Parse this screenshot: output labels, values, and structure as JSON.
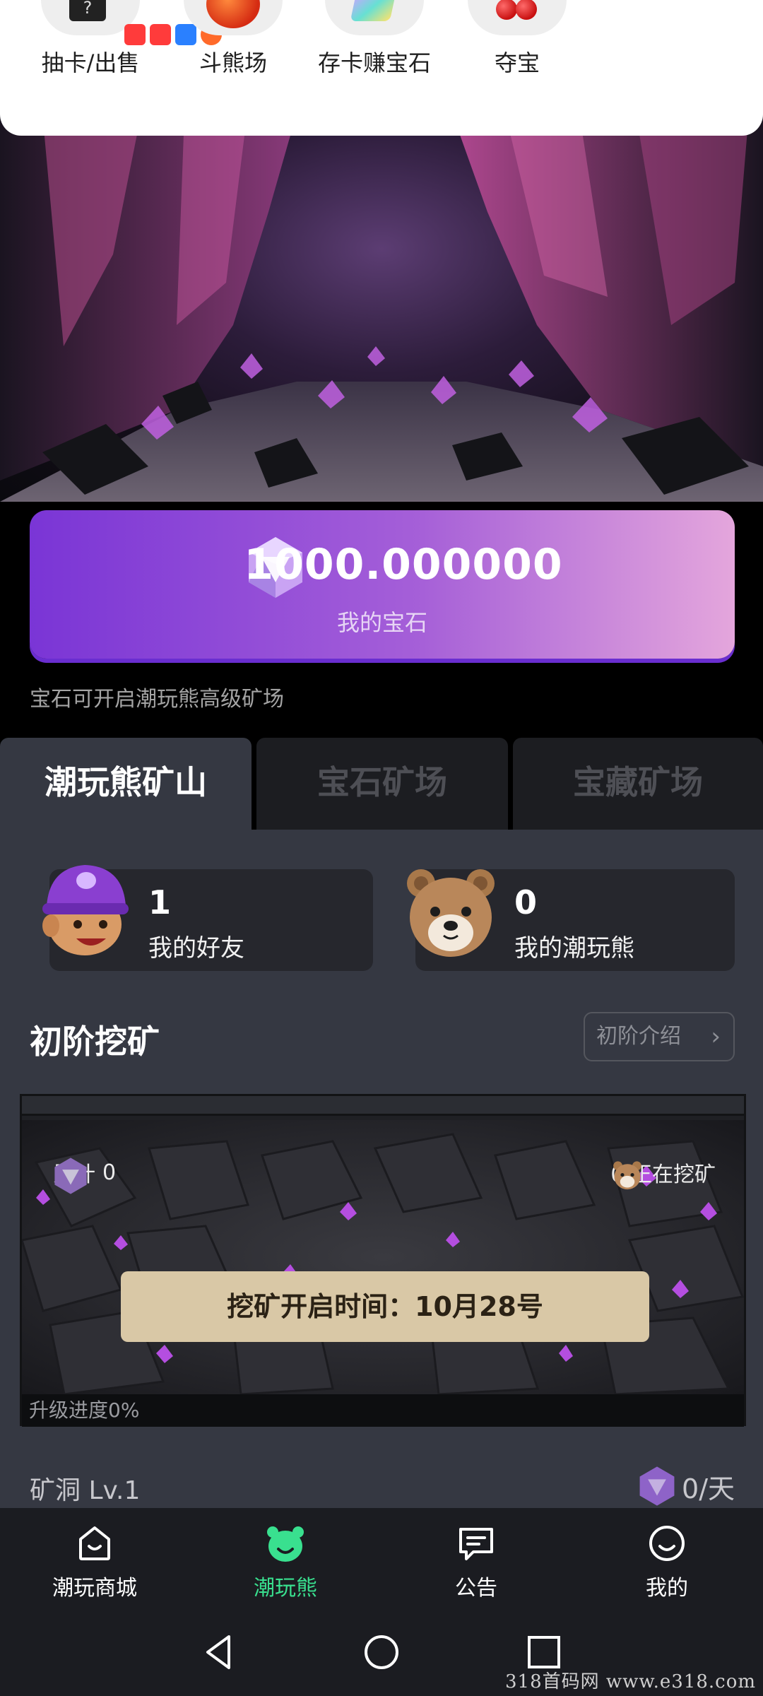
{
  "quick_actions": [
    {
      "label": "抽卡/出售",
      "icon": "mystery-box-icon"
    },
    {
      "label": "斗熊场",
      "icon": "apple-icon"
    },
    {
      "label": "存卡赚宝石",
      "icon": "gem-card-icon"
    },
    {
      "label": "夺宝",
      "icon": "cherry-icon"
    }
  ],
  "gem_card": {
    "amount": "1000.000000",
    "label": "我的宝石"
  },
  "gem_hint": "宝石可开启潮玩熊高级矿场",
  "tabs": [
    "潮玩熊矿山",
    "宝石矿场",
    "宝藏矿场"
  ],
  "stats": {
    "friends": {
      "value": "1",
      "label": "我的好友"
    },
    "bears": {
      "value": "0",
      "label": "我的潮玩熊"
    }
  },
  "section": {
    "title": "初阶挖矿",
    "intro_button": "初阶介绍"
  },
  "mine": {
    "accumulated_label": "累计",
    "accumulated_value": "0",
    "mining_text": "0 正在挖矿",
    "banner": "挖矿开启时间：10月28号",
    "progress_text": "升级进度0%",
    "progress_value": 0
  },
  "cave": {
    "level": "矿洞 Lv.1",
    "rate": "0/天"
  },
  "bottom_nav": [
    {
      "label": "潮玩商城",
      "icon": "shop-icon",
      "active": false
    },
    {
      "label": "潮玩熊",
      "icon": "bear-icon",
      "active": true
    },
    {
      "label": "公告",
      "icon": "announcement-icon",
      "active": false
    },
    {
      "label": "我的",
      "icon": "profile-icon",
      "active": false
    }
  ],
  "watermark": "318首码网 www.e318.com",
  "colors": {
    "accent": "#39e08f",
    "gem_card_start": "#7a35d6",
    "gem_card_end": "#e4a6dc",
    "panel": "#353842"
  }
}
